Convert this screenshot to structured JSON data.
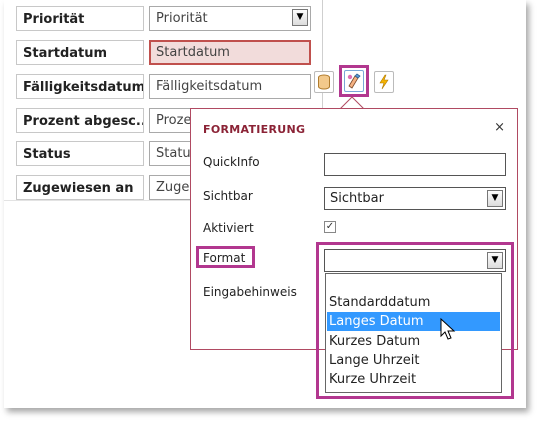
{
  "form": {
    "fields": [
      {
        "label": "Priorität",
        "control": "Priorität"
      },
      {
        "label": "Startdatum",
        "control": "Startdatum"
      },
      {
        "label": "Fälligkeitsdatum",
        "control": "Fälligkeitsdatum"
      },
      {
        "label": "Prozent abgesc...",
        "control": "Proze"
      },
      {
        "label": "Status",
        "control": "Status"
      },
      {
        "label": "Zugewiesen an",
        "control": "Zugew"
      }
    ]
  },
  "toolbar": {
    "icons": [
      "data-icon",
      "formatting-icon",
      "actions-icon"
    ]
  },
  "popup": {
    "title": "FORMATIERUNG",
    "close": "×",
    "quickinfo_label": "QuickInfo",
    "quickinfo_value": "",
    "sichtbar_label": "Sichtbar",
    "sichtbar_value": "Sichtbar",
    "aktiviert_label": "Aktiviert",
    "aktiviert_check": "✓",
    "format_label": "Format",
    "format_value": "",
    "eingabehinweis_label": "Eingabehinweis"
  },
  "format_dropdown": {
    "options": [
      "Standarddatum",
      "Langes Datum",
      "Kurzes Datum",
      "Lange Uhrzeit",
      "Kurze Uhrzeit"
    ],
    "highlighted": "Langes Datum"
  },
  "colors": {
    "highlight_border": "#b2378f",
    "popup_title": "#8b2336",
    "selected_field_fill": "#f2dcdb",
    "list_highlight": "#3399ff"
  }
}
